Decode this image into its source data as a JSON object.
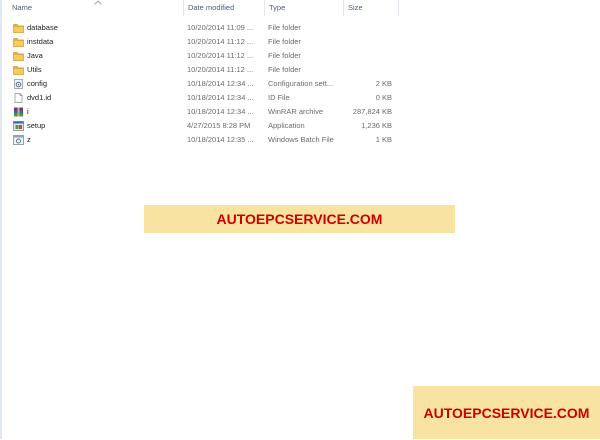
{
  "columns": {
    "name": "Name",
    "date_modified": "Date modified",
    "type": "Type",
    "size": "Size"
  },
  "files": [
    {
      "icon": "folder-icon",
      "name": "database",
      "date": "10/20/2014 11:09 ...",
      "type": "File folder",
      "size": ""
    },
    {
      "icon": "folder-icon",
      "name": "instdata",
      "date": "10/20/2014 11:12 ...",
      "type": "File folder",
      "size": ""
    },
    {
      "icon": "folder-icon",
      "name": "Java",
      "date": "10/20/2014 11:12 ...",
      "type": "File folder",
      "size": ""
    },
    {
      "icon": "folder-icon",
      "name": "Utils",
      "date": "10/20/2014 11:12 ...",
      "type": "File folder",
      "size": ""
    },
    {
      "icon": "config-file-icon",
      "name": "config",
      "date": "10/18/2014 12:34 ...",
      "type": "Configuration sett...",
      "size": "2 KB"
    },
    {
      "icon": "generic-file-icon",
      "name": "dvd1.id",
      "date": "10/18/2014 12:34 ...",
      "type": "ID File",
      "size": "0 KB"
    },
    {
      "icon": "winrar-archive-icon",
      "name": "i",
      "date": "10/18/2014 12:34 ...",
      "type": "WinRAR archive",
      "size": "287,824 KB"
    },
    {
      "icon": "setup-application-icon",
      "name": "setup",
      "date": "4/27/2015 8:28 PM",
      "type": "Application",
      "size": "1,236 KB"
    },
    {
      "icon": "batch-file-icon",
      "name": "z",
      "date": "10/18/2014 12:35 ...",
      "type": "Windows Batch File",
      "size": "1 KB"
    }
  ],
  "watermarks": {
    "center": "AUTOEPCSERVICE.COM",
    "corner": "AUTOEPCSERVICE.COM"
  },
  "colors": {
    "folder": "#e8b440",
    "watermark_bg": "#f9e3a2",
    "watermark_text": "#cc0000",
    "header_text": "#4c607a"
  }
}
